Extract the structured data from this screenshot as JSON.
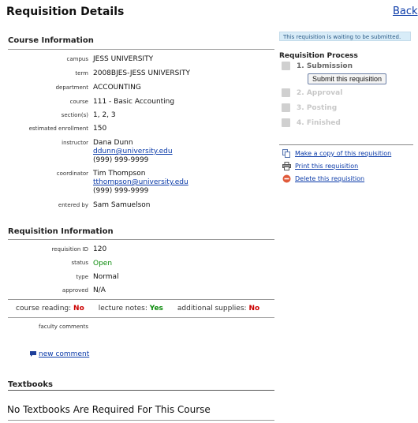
{
  "page": {
    "title": "Requisition Details",
    "back_label": "Back"
  },
  "course_info": {
    "heading": "Course Information",
    "rows": [
      {
        "label": "campus",
        "value": "JESS UNIVERSITY"
      },
      {
        "label": "term",
        "value": "2008BJES-JESS UNIVERSITY"
      },
      {
        "label": "department",
        "value": "ACCOUNTING"
      },
      {
        "label": "course",
        "value": "111 - Basic Accounting"
      },
      {
        "label": "section(s)",
        "value": "1, 2, 3"
      },
      {
        "label": "estimated enrollment",
        "value": "150"
      }
    ],
    "instructor": {
      "label": "instructor",
      "name": "Dana Dunn",
      "email": "ddunn@university.edu",
      "phone": "(999) 999-9999"
    },
    "coordinator": {
      "label": "coordinator",
      "name": "Tim Thompson",
      "email": "tthompson@university.edu",
      "phone": "(999) 999-9999"
    },
    "entered_by": {
      "label": "entered by",
      "value": "Sam Samuelson"
    }
  },
  "requisition_info": {
    "heading": "Requisition Information",
    "rows": [
      {
        "label": "requisition ID",
        "value": "120"
      },
      {
        "label": "status",
        "value": "Open"
      },
      {
        "label": "type",
        "value": "Normal"
      },
      {
        "label": "approved",
        "value": "N/A"
      }
    ],
    "flags": [
      {
        "label": "course reading:",
        "value": "No"
      },
      {
        "label": "lecture notes:",
        "value": "Yes"
      },
      {
        "label": "additional supplies:",
        "value": "No"
      }
    ],
    "faculty_comments_label": "faculty comments",
    "new_comment_label": "new comment"
  },
  "textbooks": {
    "heading": "Textbooks",
    "message": "No Textbooks Are Required For This Course"
  },
  "sidebar": {
    "notice": "This requisition is waiting to be submitted.",
    "process_heading": "Requisition Process",
    "steps": [
      {
        "label": "1. Submission",
        "state": "active"
      },
      {
        "label": "2. Approval",
        "state": "inactive"
      },
      {
        "label": "3. Posting",
        "state": "inactive"
      },
      {
        "label": "4. Finished",
        "state": "inactive"
      }
    ],
    "submit_label": "Submit this requisition",
    "actions": [
      {
        "label": "Make a copy of this requisition",
        "icon": "copy-icon"
      },
      {
        "label": "Print this requisition",
        "icon": "printer-icon"
      },
      {
        "label": "Delete this requisition",
        "icon": "delete-icon"
      }
    ]
  },
  "colors": {
    "link": "#0a3aa8",
    "open_status": "#0a8a0a",
    "no_flag": "#cc0000",
    "notice_bg": "#d8ecf8"
  }
}
